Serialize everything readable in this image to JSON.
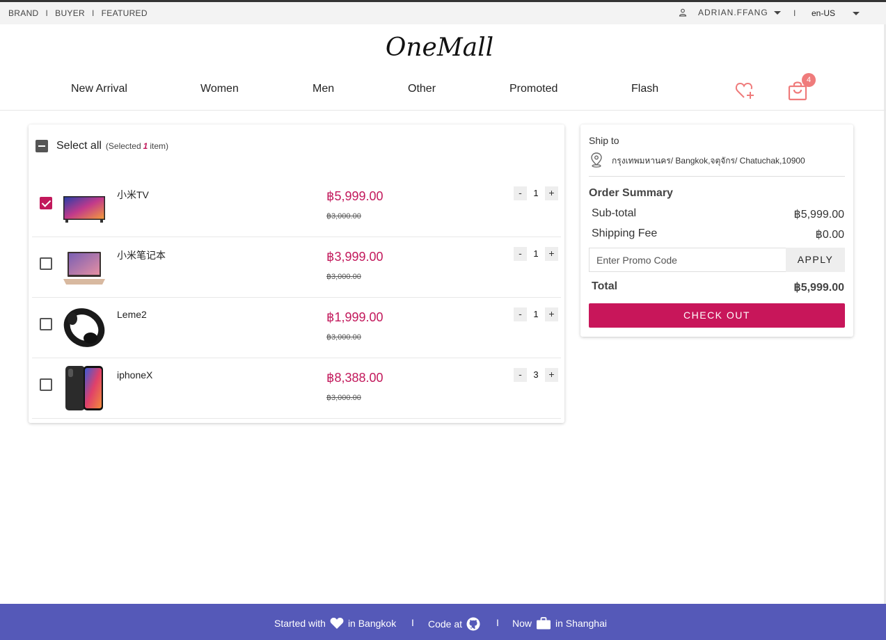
{
  "topbar": {
    "links": [
      "BRAND",
      "BUYER",
      "FEATURED"
    ],
    "username": "ADRIAN.FFANG",
    "pipe": "I",
    "language": "en-US"
  },
  "brand": {
    "logo": "OneMall"
  },
  "nav": {
    "items": [
      "New Arrival",
      "Women",
      "Men",
      "Other",
      "Promoted",
      "Flash"
    ],
    "cart_count": "4",
    "wishlist_icon": "heart-plus-icon",
    "cart_icon": "shopping-bag-icon"
  },
  "cart": {
    "select_all_label": "Select all",
    "selected_prefix": "(Selected",
    "selected_count": "1",
    "selected_suffix": "item)",
    "items": [
      {
        "name": "小米TV",
        "price": "฿5,999.00",
        "old_price": "฿3,000.00",
        "qty": "1",
        "checked": true,
        "image": "tv-thumbnail"
      },
      {
        "name": "小米笔记本",
        "price": "฿3,999.00",
        "old_price": "฿3,000.00",
        "qty": "1",
        "checked": false,
        "image": "laptop-thumbnail"
      },
      {
        "name": "Leme2",
        "price": "฿1,999.00",
        "old_price": "฿3,000.00",
        "qty": "1",
        "checked": false,
        "image": "headphones-thumbnail"
      },
      {
        "name": "iphoneX",
        "price": "฿8,388.00",
        "old_price": "฿3,000.00",
        "qty": "3",
        "checked": false,
        "image": "phone-thumbnail"
      }
    ],
    "minus": "-",
    "plus": "+"
  },
  "summary": {
    "ship_to_label": "Ship to",
    "address": "กรุงเทพมหานคร/ Bangkok,จตุจักร/ Chatuchak,10900",
    "title": "Order Summary",
    "subtotal_label": "Sub-total",
    "subtotal": "฿5,999.00",
    "shipping_label": "Shipping Fee",
    "shipping": "฿0.00",
    "promo_placeholder": "Enter Promo Code",
    "apply_label": "APPLY",
    "total_label": "Total",
    "total": "฿5,999.00",
    "checkout_label": "CHECK OUT"
  },
  "footer": {
    "started_with": "Started with",
    "in_bangkok": "in Bangkok",
    "code_at": "Code at",
    "now": "Now",
    "in_shanghai": "in Shanghai",
    "sep": "I"
  },
  "colors": {
    "accent": "#c8165a",
    "price": "#c2185b",
    "footer": "#5559b8",
    "icon_pink": "#ef7b7b"
  }
}
